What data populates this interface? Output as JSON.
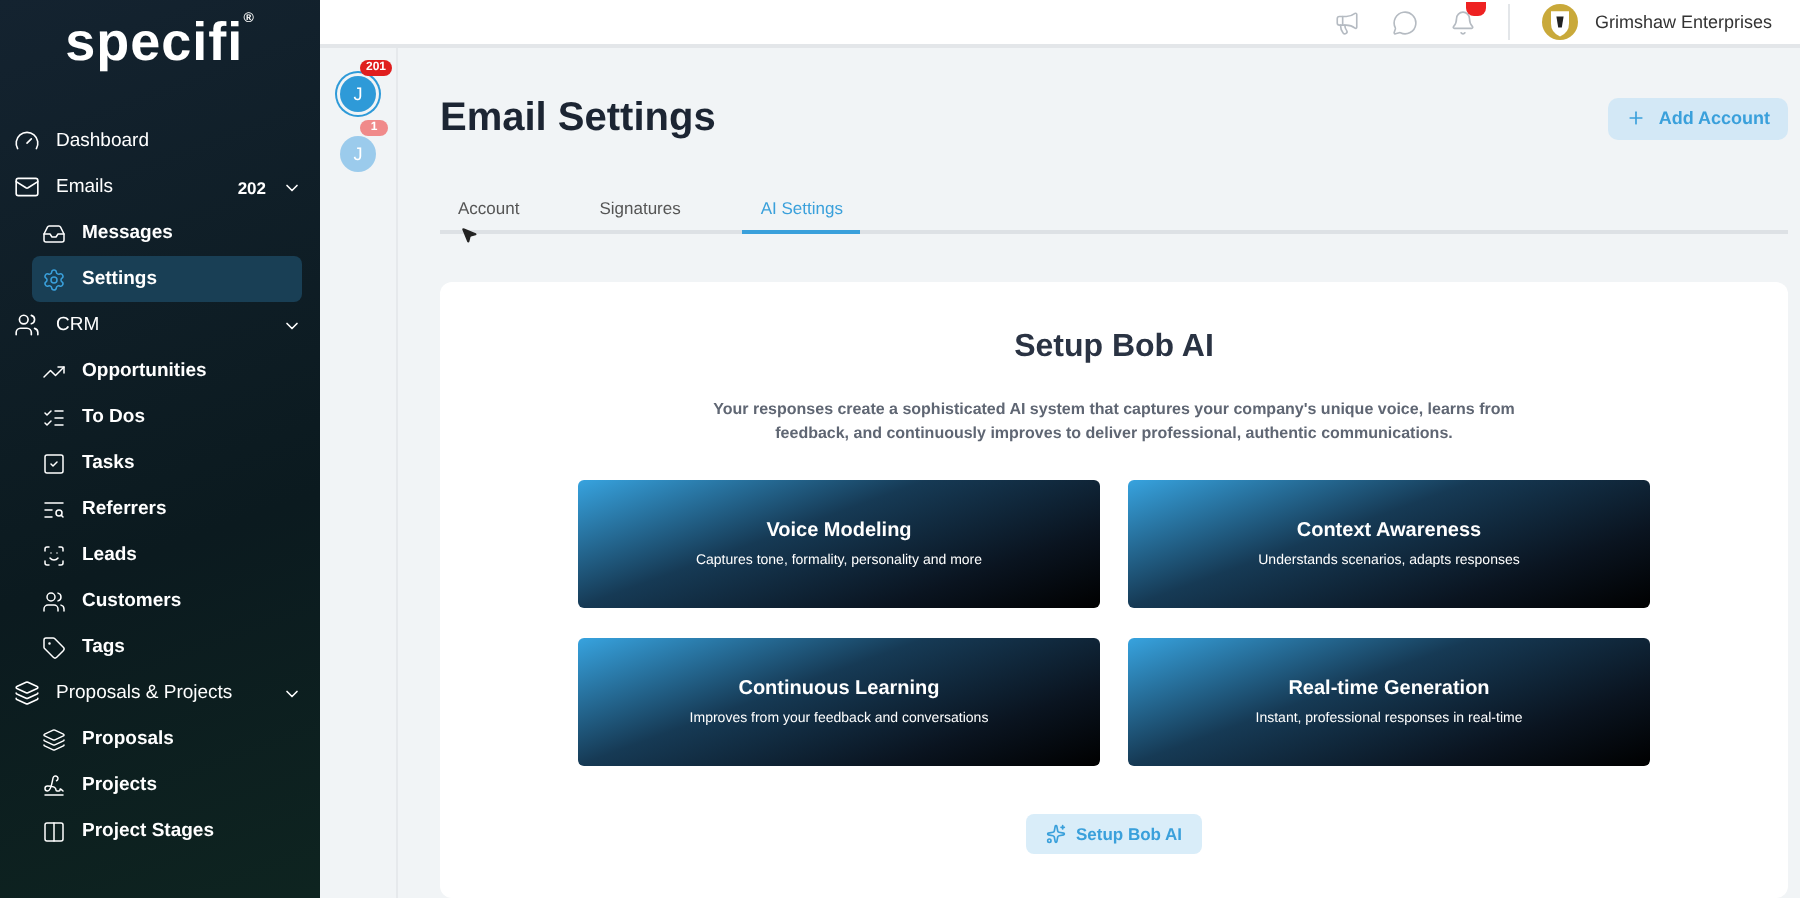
{
  "sidebar": {
    "logo": "specifi",
    "logo_mark": "®",
    "items": [
      {
        "label": "Dashboard",
        "selected": false
      },
      {
        "label": "Emails",
        "count": "202",
        "expanded": true,
        "children": [
          {
            "label": "Messages",
            "selected": false
          },
          {
            "label": "Settings",
            "selected": true
          }
        ]
      },
      {
        "label": "CRM",
        "expanded": true,
        "children": [
          {
            "label": "Opportunities",
            "selected": false
          },
          {
            "label": "To Dos",
            "selected": false
          },
          {
            "label": "Tasks",
            "selected": false
          },
          {
            "label": "Referrers",
            "selected": false
          },
          {
            "label": "Leads",
            "selected": false
          },
          {
            "label": "Customers",
            "selected": false
          },
          {
            "label": "Tags",
            "selected": false
          }
        ]
      },
      {
        "label": "Proposals & Projects",
        "expanded": true,
        "children": [
          {
            "label": "Proposals",
            "selected": false
          },
          {
            "label": "Projects",
            "selected": false
          },
          {
            "label": "Project Stages",
            "selected": false
          }
        ]
      }
    ]
  },
  "topbar": {
    "company": "Grimshaw Enterprises"
  },
  "accounts": [
    {
      "initial": "J",
      "badge": "201",
      "selected": true
    },
    {
      "initial": "J",
      "badge": "1",
      "selected": false
    }
  ],
  "page": {
    "title": "Email Settings",
    "add_button": "Add Account",
    "tabs": [
      {
        "label": "Account",
        "selected": false
      },
      {
        "label": "Signatures",
        "selected": false
      },
      {
        "label": "AI Settings",
        "selected": true
      }
    ],
    "setup": {
      "title": "Setup Bob AI",
      "description": "Your responses create a sophisticated AI system that captures your company's unique voice, learns from feedback, and continuously improves to deliver professional, authentic communications.",
      "features": [
        {
          "title": "Voice Modeling",
          "subtitle": "Captures tone, formality, personality and more"
        },
        {
          "title": "Context Awareness",
          "subtitle": "Understands scenarios, adapts responses"
        },
        {
          "title": "Continuous Learning",
          "subtitle": "Improves from your feedback and conversations"
        },
        {
          "title": "Real-time Generation",
          "subtitle": "Instant, professional responses in real-time"
        }
      ],
      "button": "Setup Bob AI"
    }
  }
}
